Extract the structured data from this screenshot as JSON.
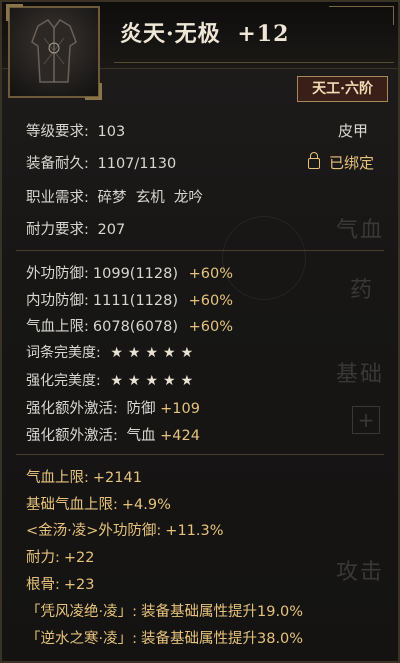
{
  "item": {
    "name": "炎天·无极",
    "enhance": "+12",
    "grade_badge": "天工·六阶",
    "type": "皮甲",
    "bound_text": "已绑定",
    "requirements": {
      "level_label": "等级要求:",
      "level_value": "103",
      "durability_label": "装备耐久:",
      "durability_value": "1107/1130",
      "class_label": "职业需求:",
      "class_value": "碎梦  玄机  龙吟",
      "stamina_label": "耐力要求:",
      "stamina_value": "207"
    },
    "base_stats": [
      {
        "label": "外功防御:",
        "value": "1099(1128)",
        "bonus": "+60%"
      },
      {
        "label": "内功防御:",
        "value": "1111(1128)",
        "bonus": "+60%"
      },
      {
        "label": "气血上限:",
        "value": "6078(6078)",
        "bonus": "+60%"
      }
    ],
    "perfection": {
      "affix_label": "词条完美度:",
      "affix_stars": 5,
      "enhance_label": "强化完美度:",
      "enhance_stars": 5
    },
    "extra_activate": [
      {
        "label": "强化额外激活:",
        "stat": "防御",
        "value": "+109"
      },
      {
        "label": "强化额外激活:",
        "stat": "气血",
        "value": "+424"
      }
    ],
    "affixes": [
      {
        "label": "气血上限:",
        "value": "+2141"
      },
      {
        "label": "基础气血上限:",
        "value": "+4.9%"
      },
      {
        "label": "<金汤·凌>外功防御:",
        "value": "+11.3%"
      },
      {
        "label": "耐力:",
        "value": "+22"
      },
      {
        "label": "根骨:",
        "value": "+23"
      },
      {
        "label": "「凭风凌绝·凌」:",
        "value": "装备基础属性提升19.0%"
      },
      {
        "label": "「逆水之寒·凌」:",
        "value": "装备基础属性提升38.0%"
      }
    ]
  },
  "background_ui": {
    "label_qixue": "气血",
    "label_yao": "药",
    "label_jichu": "基础",
    "label_gongji": "攻击",
    "plus": "+"
  },
  "colors": {
    "gold": "#e6c27c",
    "text": "#d9d6cf",
    "badge_bg": "#3a1f18"
  }
}
